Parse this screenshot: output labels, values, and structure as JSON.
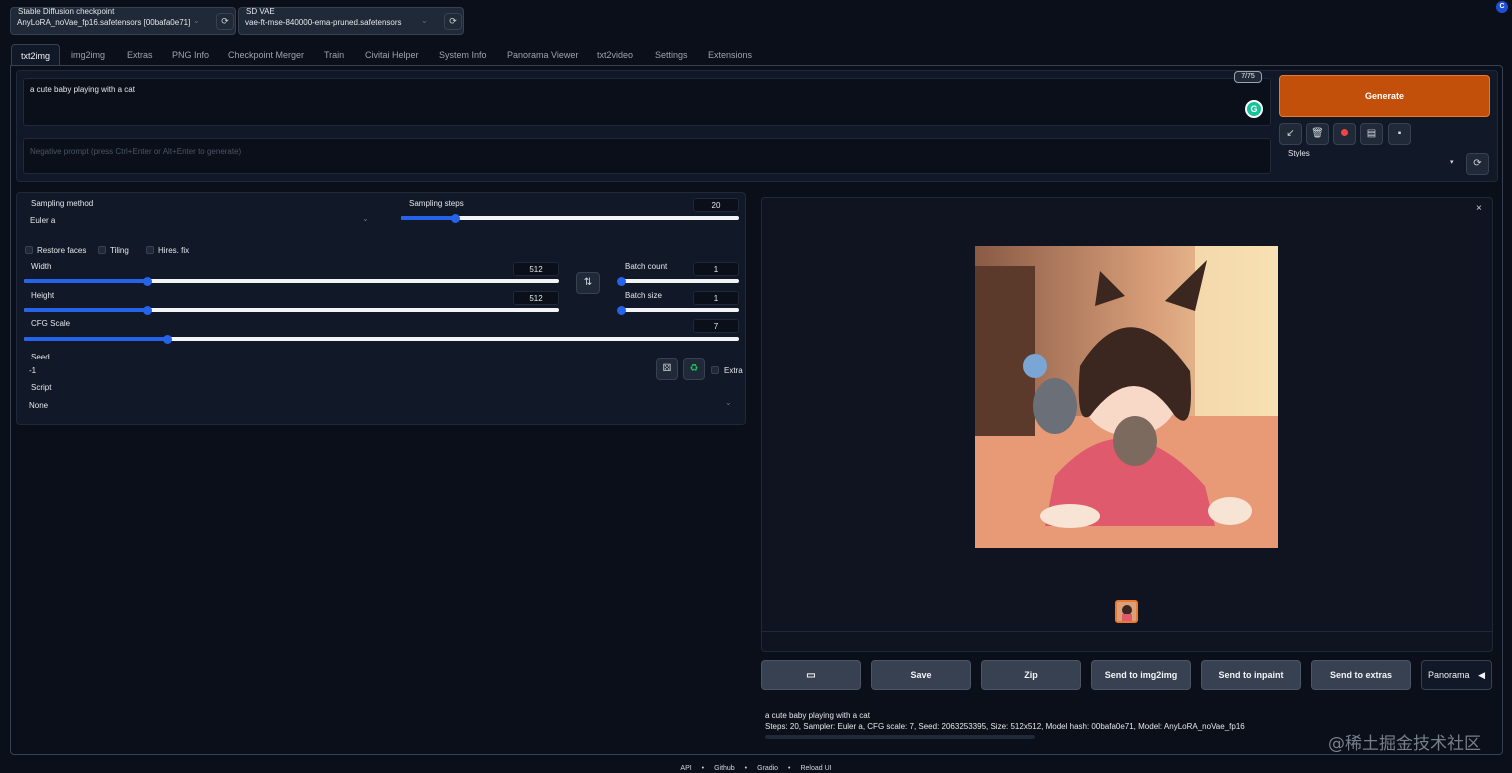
{
  "header": {
    "checkpoint_label": "Stable Diffusion checkpoint",
    "checkpoint_value": "AnyLoRA_noVae_fp16.safetensors [00bafa0e71]",
    "vae_label": "SD VAE",
    "vae_value": "vae-ft-mse-840000-ema-pruned.safetensors"
  },
  "tabs": [
    "txt2img",
    "img2img",
    "Extras",
    "PNG Info",
    "Checkpoint Merger",
    "Train",
    "Civitai Helper",
    "System Info",
    "Panorama Viewer",
    "txt2video",
    "Settings",
    "Extensions"
  ],
  "prompt": {
    "text": "a cute baby playing with a cat",
    "token_count": "7/75",
    "negative_placeholder": "Negative prompt (press Ctrl+Enter or Alt+Enter to generate)"
  },
  "actions": {
    "generate_label": "Generate",
    "styles_label": "Styles"
  },
  "params": {
    "sampling_method_label": "Sampling method",
    "sampling_method_value": "Euler a",
    "sampling_steps_label": "Sampling steps",
    "sampling_steps_value": "20",
    "restore_faces_label": "Restore faces",
    "tiling_label": "Tiling",
    "hires_fix_label": "Hires. fix",
    "width_label": "Width",
    "width_value": "512",
    "height_label": "Height",
    "height_value": "512",
    "batch_count_label": "Batch count",
    "batch_count_value": "1",
    "batch_size_label": "Batch size",
    "batch_size_value": "1",
    "cfg_label": "CFG Scale",
    "cfg_value": "7",
    "seed_label": "Seed",
    "seed_value": "-1",
    "extra_label": "Extra",
    "script_label": "Script",
    "script_value": "None"
  },
  "slider_levels": {
    "sampling_steps": 0.16,
    "width": 0.23,
    "height": 0.23,
    "batch_count": 0.0,
    "batch_size": 0.0,
    "cfg": 0.2
  },
  "output": {
    "buttons": [
      "Save",
      "Zip",
      "Send to img2img",
      "Send to inpaint",
      "Send to extras"
    ],
    "panorama_label": "Panorama",
    "info_prompt": "a cute baby playing with a cat",
    "info_params": "Steps: 20, Sampler: Euler a, CFG scale: 7, Seed: 2063253395, Size: 512x512, Model hash: 00bafa0e71, Model: AnyLoRA_noVae_fp16"
  },
  "footer": {
    "links": [
      "API",
      "Github",
      "Gradio",
      "Reload UI"
    ]
  },
  "watermark": "@稀土掘金技术社区",
  "colors": {
    "background": "#0b0f19",
    "panel": "#111827",
    "generate": "#c2500a",
    "slider": "#2563eb"
  }
}
